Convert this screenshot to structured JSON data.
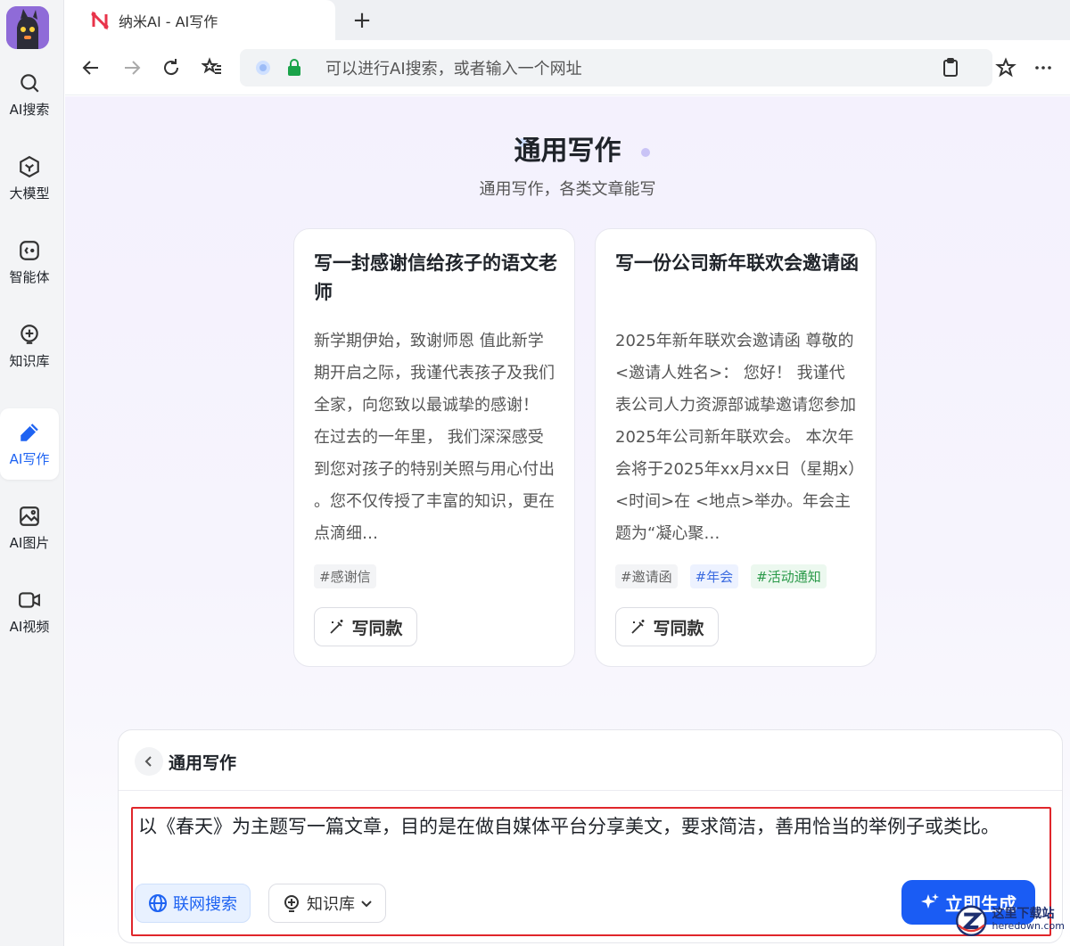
{
  "browser": {
    "tab_title": "纳米AI - AI写作",
    "newtab": "+",
    "address_placeholder": "可以进行AI搜索，或者输入一个网址"
  },
  "sidebar": {
    "items": [
      {
        "label": "AI搜索",
        "icon": "search-icon"
      },
      {
        "label": "大模型",
        "icon": "cube-icon"
      },
      {
        "label": "智能体",
        "icon": "agent-icon"
      },
      {
        "label": "知识库",
        "icon": "bulb-icon"
      },
      {
        "label": "AI写作",
        "icon": "pen-icon",
        "active": true
      },
      {
        "label": "AI图片",
        "icon": "image-icon"
      },
      {
        "label": "AI视频",
        "icon": "video-icon"
      }
    ]
  },
  "page": {
    "title": "通用写作",
    "subtitle": "通用写作，各类文章能写"
  },
  "cards": [
    {
      "title": "写一封感谢信给孩子的语文老师",
      "body": "新学期伊始，致谢师恩 值此新学期开启之际，我谨代表孩子及我们全家，向您致以最诚挚的感谢！ 在过去的一年里， 我们深深感受到您对孩子的特别关照与用心付出 。您不仅传授了丰富的知识，更在点滴细…",
      "tags": [
        "#感谢信"
      ],
      "button": "写同款"
    },
    {
      "title": "写一份公司新年联欢会邀请函",
      "body": "2025年新年联欢会邀请函 尊敬的<邀请人姓名>： 您好！ 我谨代表公司人力资源部诚挚邀请您参加2025年公司新年联欢会。 本次年会将于2025年xx月xx日（星期x）<时间>在 <地点>举办。年会主题为“凝心聚…",
      "tags": [
        "#邀请函",
        "#年会",
        "#活动通知"
      ],
      "button": "写同款"
    }
  ],
  "composer": {
    "title": "通用写作",
    "prompt": "以《春天》为主题写一篇文章，目的是在做自媒体平台分享美文，要求简洁，善用恰当的举例子或类比。",
    "web_search": "联网搜索",
    "knowledge": "知识库",
    "generate": "立即生成"
  },
  "watermark": {
    "cn": "这里下载站",
    "en": "heredown.com"
  },
  "colors": {
    "accent": "#1a5cf4",
    "highlight_border": "#e0262b",
    "active_nav": "#1e63f2"
  }
}
